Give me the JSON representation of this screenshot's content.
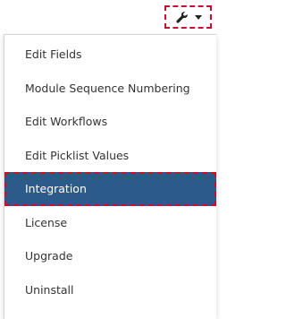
{
  "toolbar": {
    "settings_icon": "wrench-icon",
    "dropdown_icon": "caret-down-icon"
  },
  "menu": {
    "items": [
      {
        "label": "Edit Fields"
      },
      {
        "label": "Module Sequence Numbering"
      },
      {
        "label": "Edit Workflows"
      },
      {
        "label": "Edit Picklist Values"
      },
      {
        "label": "Integration",
        "active": true
      },
      {
        "label": "License"
      },
      {
        "label": "Upgrade"
      },
      {
        "label": "Uninstall"
      }
    ]
  },
  "colors": {
    "active_background": "#2c5b8a",
    "highlight_border": "#c8102e",
    "text": "#333333"
  }
}
